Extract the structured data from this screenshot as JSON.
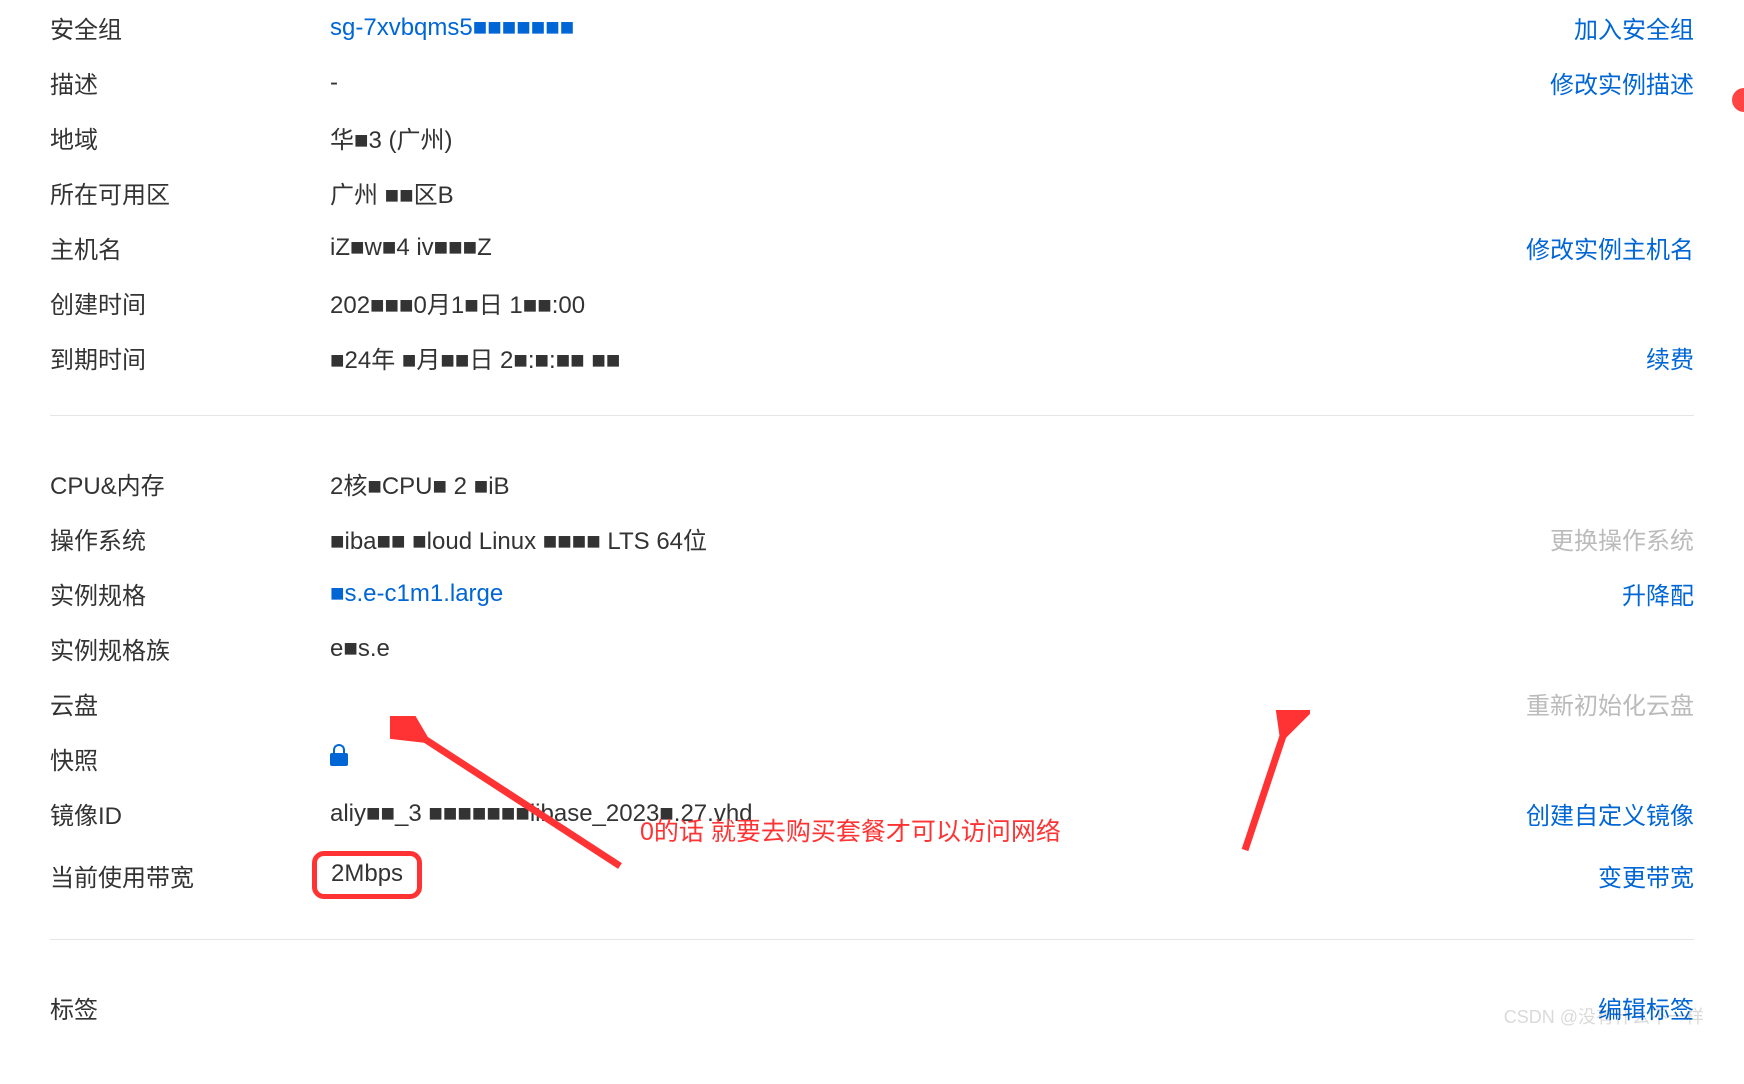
{
  "rows": {
    "security_group": {
      "label": "安全组",
      "value": "sg-7xvbqms5■■■■■■■",
      "action": "加入安全组"
    },
    "description": {
      "label": "描述",
      "value": "-",
      "action": "修改实例描述"
    },
    "region": {
      "label": "地域",
      "value": "华■3 (广州)"
    },
    "zone": {
      "label": "所在可用区",
      "value": "广州 ■■区B"
    },
    "hostname": {
      "label": "主机名",
      "value": "iZ■w■4 iv■■■Z",
      "action": "修改实例主机名"
    },
    "created_time": {
      "label": "创建时间",
      "value": "202■■■0月1■日 1■■:00"
    },
    "expire_time": {
      "label": "到期时间",
      "value": "■24年 ■月■■日 2■:■:■■ ■■",
      "action": "续费"
    },
    "cpu_mem": {
      "label": "CPU&内存",
      "value": "2核■CPU■ 2 ■iB"
    },
    "os": {
      "label": "操作系统",
      "value": "■iba■■ ■loud Linux ■■■■ LTS 64位",
      "action": "更换操作系统"
    },
    "instance_type": {
      "label": "实例规格",
      "value": "■s.e-c1m1.large",
      "action": "升降配"
    },
    "instance_family": {
      "label": "实例规格族",
      "value": "e■s.e"
    },
    "disk": {
      "label": "云盘",
      "value": "",
      "action": "重新初始化云盘"
    },
    "snapshot": {
      "label": "快照",
      "value": ""
    },
    "image_id": {
      "label": "镜像ID",
      "value": "aliy■■_3 ■■■■■■■libase_2023■.27.vhd",
      "action": "创建自定义镜像"
    },
    "bandwidth": {
      "label": "当前使用带宽",
      "value": "2Mbps",
      "action": "变更带宽"
    },
    "tags": {
      "label": "标签",
      "action": "编辑标签"
    }
  },
  "annotation": "0的话 就要去购买套餐才可以访问网络",
  "watermark": "CSDN @没有什么不一样"
}
